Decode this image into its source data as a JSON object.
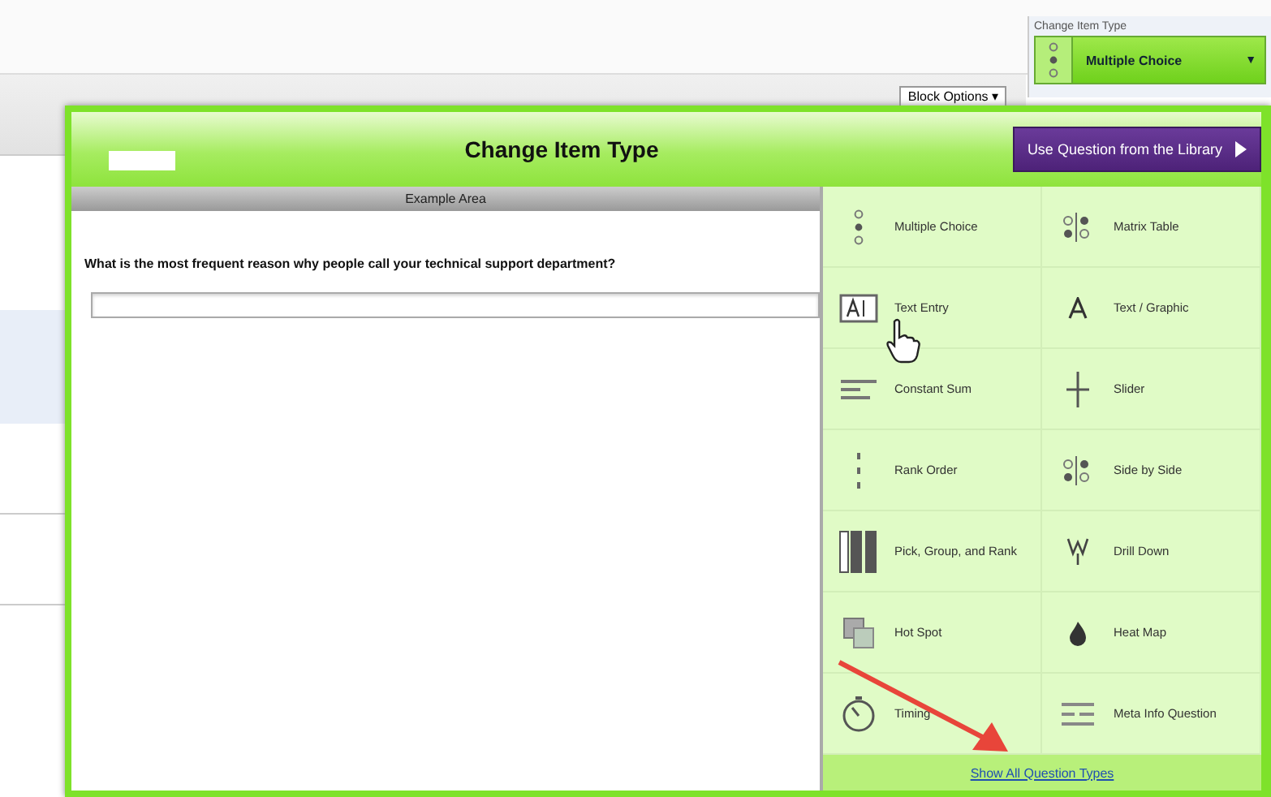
{
  "page": {
    "block_options": "Block Options ▾",
    "item_type_panel": {
      "label": "Change Item Type",
      "value": "Multiple Choice",
      "caret": "▼"
    }
  },
  "dialog": {
    "title": "Change Item Type",
    "library_button": "Use Question from the Library",
    "example": {
      "header": "Example Area",
      "question": "What is the most frequent reason why people call your technical support department?"
    },
    "types": [
      {
        "kind": "multiple-choice",
        "label": "Multiple Choice"
      },
      {
        "kind": "matrix",
        "label": "Matrix Table"
      },
      {
        "kind": "text-entry",
        "label": "Text Entry"
      },
      {
        "kind": "graphic",
        "label": "Text / Graphic"
      },
      {
        "kind": "constant-sum",
        "label": "Constant Sum"
      },
      {
        "kind": "slider",
        "label": "Slider"
      },
      {
        "kind": "rank",
        "label": "Rank Order"
      },
      {
        "kind": "matrix",
        "label": "Side by Side"
      },
      {
        "kind": "pgr",
        "label": "Pick, Group, and Rank"
      },
      {
        "kind": "drill",
        "label": "Drill Down"
      },
      {
        "kind": "hotspot",
        "label": "Hot Spot"
      },
      {
        "kind": "heat",
        "label": "Heat Map"
      },
      {
        "kind": "timing",
        "label": "Timing"
      },
      {
        "kind": "meta",
        "label": "Meta Info Question"
      }
    ],
    "show_all": "Show All Question Types"
  }
}
